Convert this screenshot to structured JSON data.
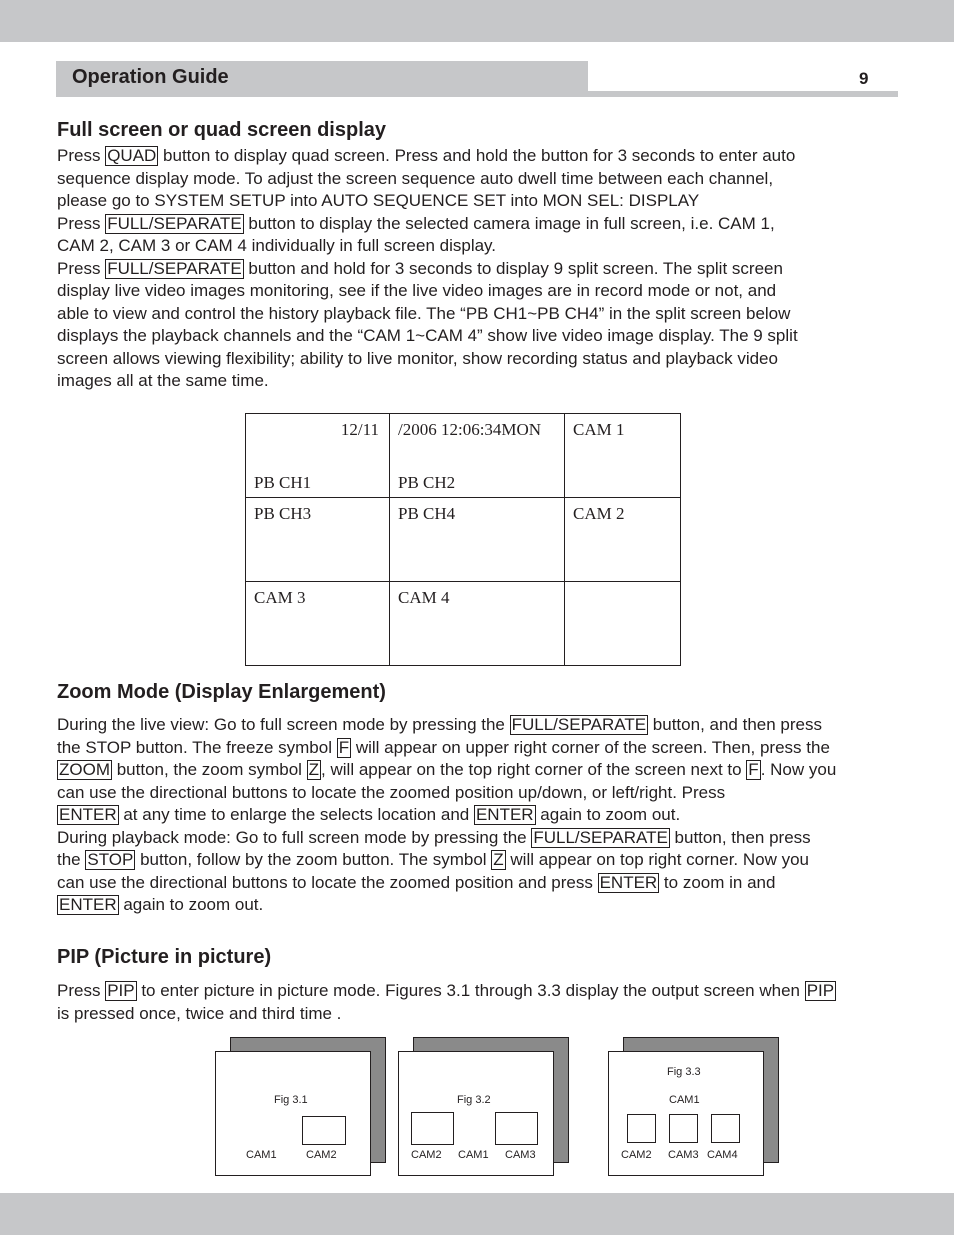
{
  "header": {
    "title": "Operation Guide",
    "page_number": "9"
  },
  "sections": {
    "full_screen": {
      "heading": "Full screen or quad screen display",
      "lines": [
        {
          "pre": "Press ",
          "key": "QUAD",
          "post": " button to display quad screen. Press and hold the button for 3 seconds to enter auto"
        },
        {
          "pre": "sequence display mode. To adjust the screen sequence auto dwell time between each channel,"
        },
        {
          "pre": "please go to SYSTEM SETUP into AUTO SEQUENCE SET  into MON SEL: DISPLAY"
        },
        {
          "pre": "Press ",
          "key": "FULL/SEPARATE",
          "post": " button to display the selected camera image in full screen, i.e. CAM 1,"
        },
        {
          "pre": "CAM 2, CAM 3 or CAM 4 individually in full screen display."
        },
        {
          "pre": "Press ",
          "key": "FULL/SEPARATE",
          "post": " button and hold for 3 seconds to display 9 split screen. The split screen"
        },
        {
          "pre": "display live video images monitoring, see if the live video images are in record mode or not, and"
        },
        {
          "pre": "able to view and control the history playback file. The “PB CH1~PB CH4” in the split screen below"
        },
        {
          "pre": "displays the playback channels and the “CAM 1~CAM 4” show live video image display. The 9 split"
        },
        {
          "pre": "screen allows viewing flexibility; ability to live monitor, show recording status and playback video"
        },
        {
          "pre": "images all at the same time."
        }
      ]
    },
    "split_screen": {
      "date_part1": "12/11",
      "date_part2": "/2006 12:06:34MON",
      "cells": {
        "r1c1": "PB CH1",
        "r1c2": "PB CH2",
        "r1c3": "CAM 1",
        "r2c1": "PB CH3",
        "r2c2": "PB CH4",
        "r2c3": "CAM 2",
        "r3c1": "CAM 3",
        "r3c2": "CAM 4",
        "r3c3": ""
      }
    },
    "zoom_mode": {
      "heading": "Zoom Mode (Display Enlargement)",
      "lines": [
        [
          {
            "t": "During the live view: Go to full screen mode by pressing the "
          },
          {
            "k": "FULL/SEPARATE"
          },
          {
            "t": " button, and then press"
          }
        ],
        [
          {
            "t": "the STOP button. The freeze symbol "
          },
          {
            "k": "F"
          },
          {
            "t": " will appear on upper right corner of the screen. Then, press the"
          }
        ],
        [
          {
            "k": "ZOOM"
          },
          {
            "t": " button, the zoom symbol "
          },
          {
            "k": "Z"
          },
          {
            "t": ", will appear on the top right corner of the screen next to "
          },
          {
            "k": "F"
          },
          {
            "t": ". Now you"
          }
        ],
        [
          {
            "t": "can use the directional buttons to locate the zoomed position up/down, or left/right. Press"
          }
        ],
        [
          {
            "k": "ENTER"
          },
          {
            "t": " at any time to enlarge the selects location and "
          },
          {
            "k": "ENTER"
          },
          {
            "t": " again to zoom out."
          }
        ],
        [
          {
            "t": "During  playback mode: Go to full screen mode by pressing the "
          },
          {
            "k": "FULL/SEPARATE "
          },
          {
            "t": " button, then press"
          }
        ],
        [
          {
            "t": "the "
          },
          {
            "k": "STOP"
          },
          {
            "t": " button, follow by the zoom button. The symbol "
          },
          {
            "k": "Z"
          },
          {
            "t": " will appear on top right corner. Now you"
          }
        ],
        [
          {
            "t": "can use the directional buttons to locate the zoomed position and press "
          },
          {
            "k": "ENTER"
          },
          {
            "t": " to zoom in and"
          }
        ],
        [
          {
            "k": "ENTER"
          },
          {
            "t": " again to zoom out."
          }
        ]
      ]
    },
    "pip": {
      "heading": "PIP (Picture in picture)",
      "lines": [
        [
          {
            "t": "Press "
          },
          {
            "k": "PIP"
          },
          {
            "t": " to enter picture in picture mode. Figures 3.1 through 3.3 display the output screen when "
          },
          {
            "k": "PIP"
          }
        ],
        [
          {
            "t": "is pressed once, twice and third time ."
          }
        ]
      ],
      "figures": [
        {
          "caption": "Fig 3.1",
          "labels": [
            "CAM1",
            "CAM2"
          ]
        },
        {
          "caption": "Fig 3.2",
          "labels": [
            "CAM2",
            "CAM1",
            "CAM3"
          ]
        },
        {
          "caption": "Fig 3.3",
          "labels": [
            "CAM1",
            "CAM2",
            "CAM3",
            "CAM4"
          ]
        }
      ]
    }
  }
}
